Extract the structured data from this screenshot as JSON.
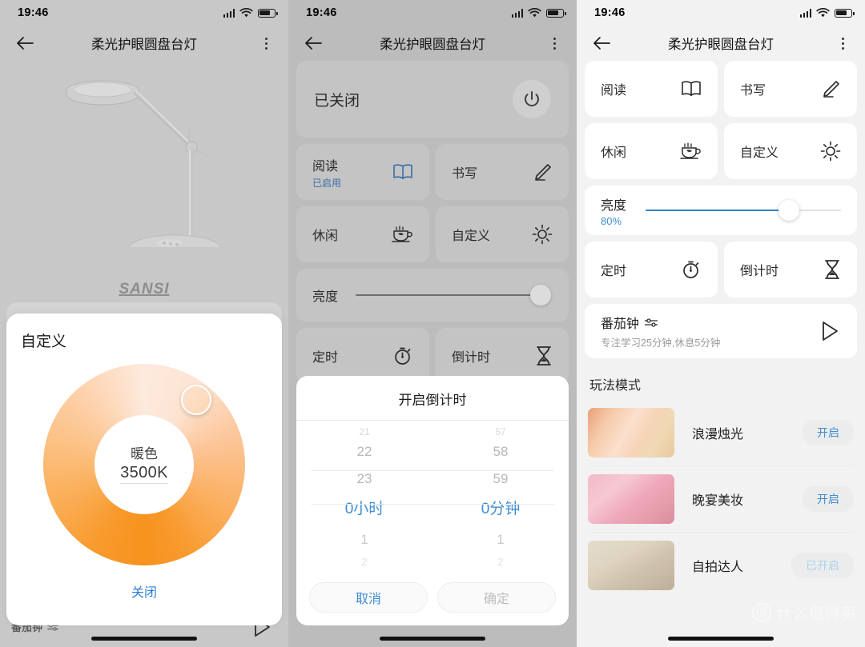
{
  "status_bar": {
    "time": "19:46",
    "signal_icon": "signal-bars-icon",
    "wifi_icon": "wifi-icon",
    "battery_icon": "battery-icon"
  },
  "header": {
    "title": "柔光护眼圆盘台灯",
    "back_icon": "back-arrow-icon",
    "menu_icon": "more-options-icon"
  },
  "panel1": {
    "product": {
      "brand": "SANSI",
      "image_alt": "desk-lamp-image"
    },
    "behind_row": {
      "label": "番茄钟",
      "play_icon": "play-icon"
    },
    "custom_dialog": {
      "title": "自定义",
      "color_label": "暖色",
      "temperature": "3500K",
      "close_label": "关闭",
      "wheel_start_color": "#f7931e",
      "wheel_end_color": "#fdeade",
      "accent": "#2b7fd4"
    }
  },
  "panel2": {
    "power": {
      "status": "已关闭",
      "power_icon": "power-icon"
    },
    "modes": [
      {
        "label": "阅读",
        "sub": "已启用",
        "icon": "book-icon"
      },
      {
        "label": "书写",
        "sub": "",
        "icon": "pencil-icon"
      },
      {
        "label": "休闲",
        "sub": "",
        "icon": "teacup-icon"
      },
      {
        "label": "自定义",
        "sub": "",
        "icon": "sun-icon"
      }
    ],
    "brightness": {
      "label": "亮度",
      "value": ""
    },
    "timers": [
      {
        "label": "定时",
        "icon": "stopwatch-icon"
      },
      {
        "label": "倒计时",
        "icon": "hourglass-icon"
      }
    ],
    "countdown_dialog": {
      "title": "开启倒计时",
      "hours": {
        "far_prev": "21",
        "prev": "22",
        "near_prev": "23",
        "selected": "0小时",
        "next": "1",
        "far_next": "2"
      },
      "minutes": {
        "far_prev": "57",
        "prev": "58",
        "near_prev": "59",
        "selected": "0分钟",
        "next": "1",
        "far_next": "2"
      },
      "cancel_label": "取消",
      "confirm_label": "确定"
    }
  },
  "panel3": {
    "modes": [
      {
        "label": "阅读",
        "icon": "book-icon"
      },
      {
        "label": "书写",
        "icon": "pencil-icon"
      },
      {
        "label": "休闲",
        "icon": "teacup-icon"
      },
      {
        "label": "自定义",
        "icon": "sun-icon"
      }
    ],
    "brightness": {
      "label": "亮度",
      "value": "80%",
      "accent": "#2b84c4"
    },
    "timers": [
      {
        "label": "定时",
        "icon": "stopwatch-icon"
      },
      {
        "label": "倒计时",
        "icon": "hourglass-icon"
      }
    ],
    "pomodoro": {
      "title": "番茄钟",
      "settings_icon": "sliders-icon",
      "subtitle": "专注学习25分钟,休息5分钟",
      "play_icon": "play-icon"
    },
    "section_title": "玩法模式",
    "play_modes": [
      {
        "name": "浪漫烛光",
        "button": "开启",
        "active": false,
        "thumb": "candlelight-thumbnail"
      },
      {
        "name": "晚宴美妆",
        "button": "开启",
        "active": false,
        "thumb": "makeup-thumbnail"
      },
      {
        "name": "自拍达人",
        "button": "已开启",
        "active": true,
        "thumb": "selfie-thumbnail"
      }
    ]
  },
  "watermark": {
    "badge": "值",
    "text": "什么值得买"
  }
}
